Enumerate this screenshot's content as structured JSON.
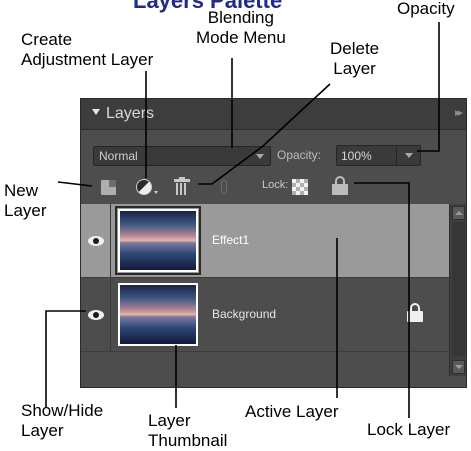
{
  "heading": {
    "fragment": "Layers Palette"
  },
  "callouts": {
    "blending_mode_menu": "Blending\nMode Menu",
    "opacity": "Opacity",
    "create_adjustment_layer": "Create\nAdjustment Layer",
    "delete_layer": "Delete\nLayer",
    "new_layer": "New\nLayer",
    "show_hide_layer": "Show/Hide\nLayer",
    "layer_thumbnail": "Layer\nThumbnail",
    "active_layer": "Active Layer",
    "lock_layer": "Lock Layer"
  },
  "panel": {
    "title": "Layers",
    "menu_icon": "panel-menu-icon",
    "blend_mode": {
      "value": "Normal"
    },
    "opacity": {
      "label": "Opacity:",
      "value": "100%"
    },
    "toolbar": {
      "new_layer_icon": "new-layer-icon",
      "adjustment_icon": "half-circle-icon",
      "delete_icon": "trash-icon",
      "link_icon": "link-icon",
      "lock_label": "Lock:",
      "lock_transparent_icon": "checkerboard-icon",
      "lock_all_icon": "padlock-icon"
    },
    "layers": [
      {
        "name": "Effect1",
        "active": true,
        "visible": true,
        "locked": false
      },
      {
        "name": "Background",
        "active": false,
        "visible": true,
        "locked": true
      }
    ]
  },
  "colors": {
    "heading": "#1f2b86",
    "panel_bg": "#4d4d4d",
    "active_row": "#9a9a9a"
  }
}
